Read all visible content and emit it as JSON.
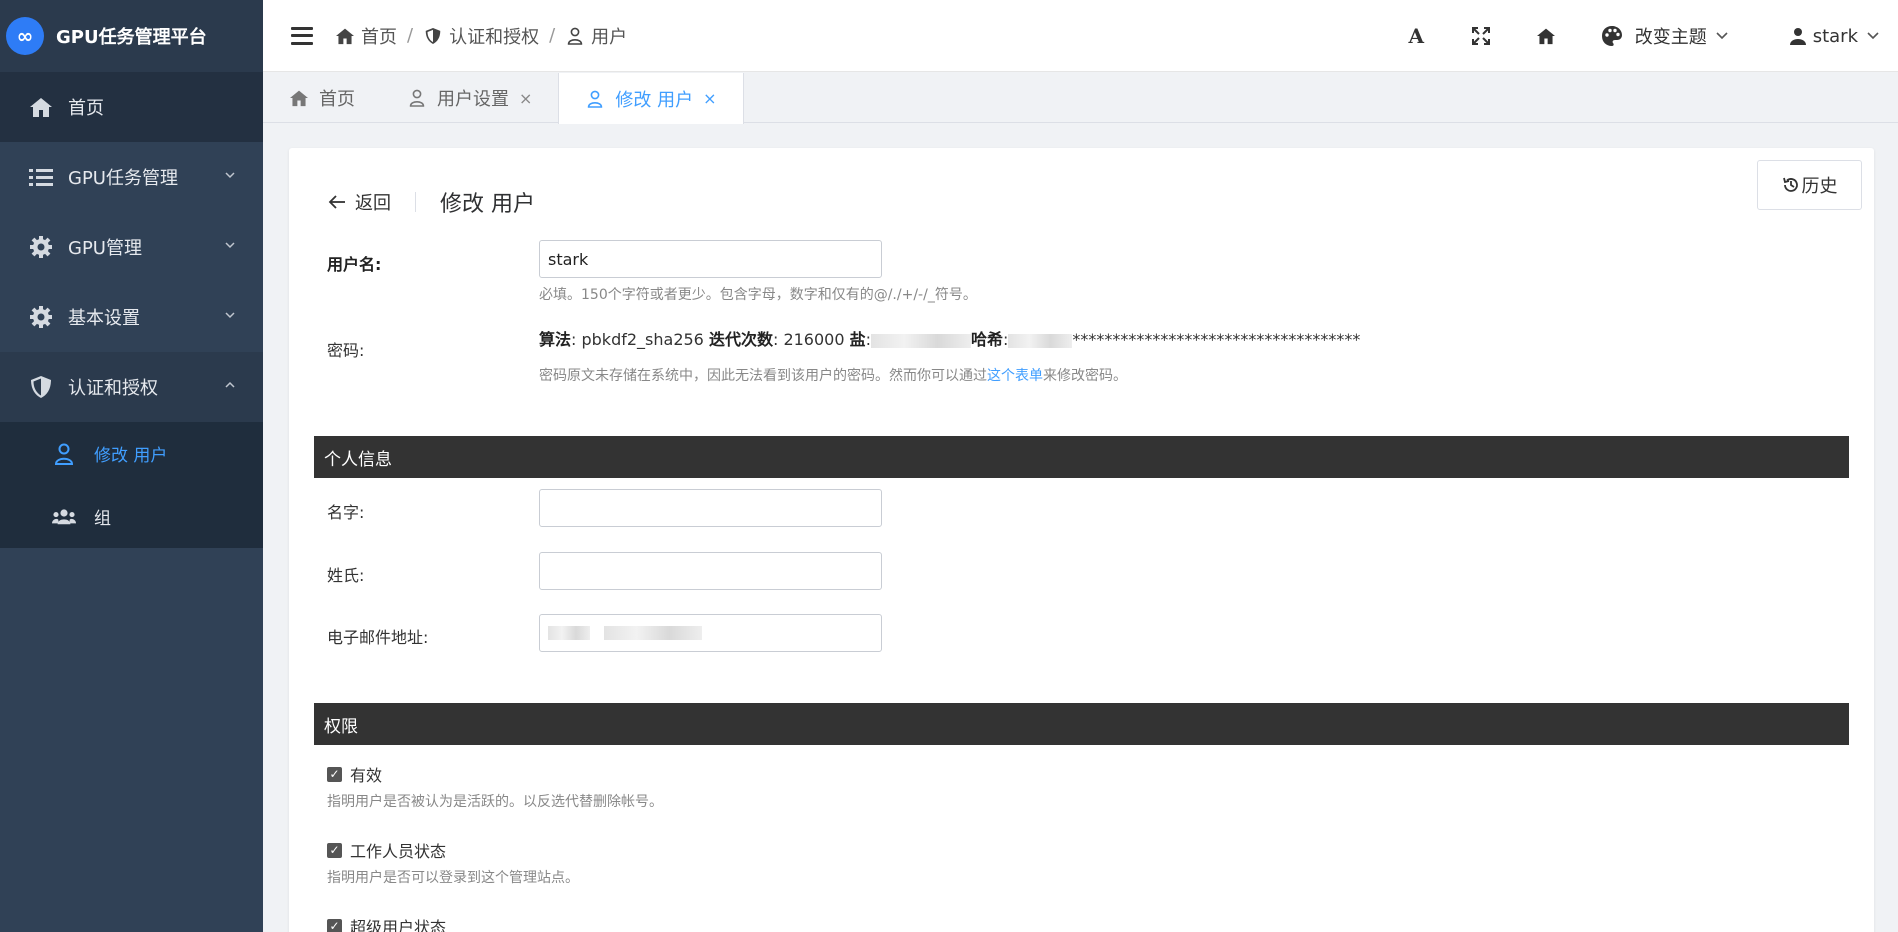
{
  "app": {
    "title": "GPU任务管理平台",
    "logo_glyph": "∞",
    "accent": "#409eff",
    "sidebar_bg": "#304156"
  },
  "sidebar": {
    "items": [
      {
        "label": "首页",
        "icon": "home-icon"
      },
      {
        "label": "GPU任务管理",
        "icon": "list-icon"
      },
      {
        "label": "GPU管理",
        "icon": "gear-icon"
      },
      {
        "label": "基本设置",
        "icon": "gear-icon"
      },
      {
        "label": "认证和授权",
        "icon": "shield-icon"
      }
    ],
    "sub_items": [
      {
        "label": "修改 用户",
        "icon": "user-icon",
        "active": true
      },
      {
        "label": "组",
        "icon": "users-icon",
        "active": false
      }
    ]
  },
  "header": {
    "breadcrumb": [
      "首页",
      "认证和授权",
      "用户"
    ],
    "separators": [
      "/",
      "/"
    ],
    "theme_label": "改变主题",
    "user_label": "stark",
    "font_btn": "A"
  },
  "tabs": [
    {
      "label": "首页",
      "icon": "home-icon",
      "closable": false,
      "active": false
    },
    {
      "label": "用户设置",
      "icon": "user-icon",
      "closable": true,
      "active": false
    },
    {
      "label": "修改 用户",
      "icon": "user-icon",
      "closable": true,
      "active": true
    }
  ],
  "tab_close_glyph": "×",
  "content": {
    "back_label": "返回",
    "page_title": "修改 用户",
    "history_label": "历史",
    "username": {
      "label": "用户名:",
      "value": "stark",
      "help": "必填。150个字符或者更少。包含字母，数字和仅有的@/./+/-/_符号。"
    },
    "password": {
      "label": "密码:",
      "algo_label": "算法",
      "algo_value": ": pbkdf2_sha256 ",
      "iter_label": "迭代次数",
      "iter_value": ": 216000 ",
      "salt_label": "盐",
      "hash_label": "哈希",
      "hash_value": "************************************",
      "help_before": "密码原文未存储在系统中，因此无法看到该用户的密码。然而你可以通过",
      "help_link": "这个表单",
      "help_after": "来修改密码。"
    },
    "personal_section": "个人信息",
    "first_name": {
      "label": "名字:",
      "value": ""
    },
    "last_name": {
      "label": "姓氏:",
      "value": ""
    },
    "email": {
      "label": "电子邮件地址:"
    },
    "permissions_section": "权限",
    "checks": [
      {
        "label": "有效",
        "help": "指明用户是否被认为是活跃的。以反选代替删除帐号。",
        "checked": true
      },
      {
        "label": "工作人员状态",
        "help": "指明用户是否可以登录到这个管理站点。",
        "checked": true
      },
      {
        "label": "超级用户状态",
        "help": "",
        "checked": true
      }
    ],
    "check_glyph": "✓"
  }
}
